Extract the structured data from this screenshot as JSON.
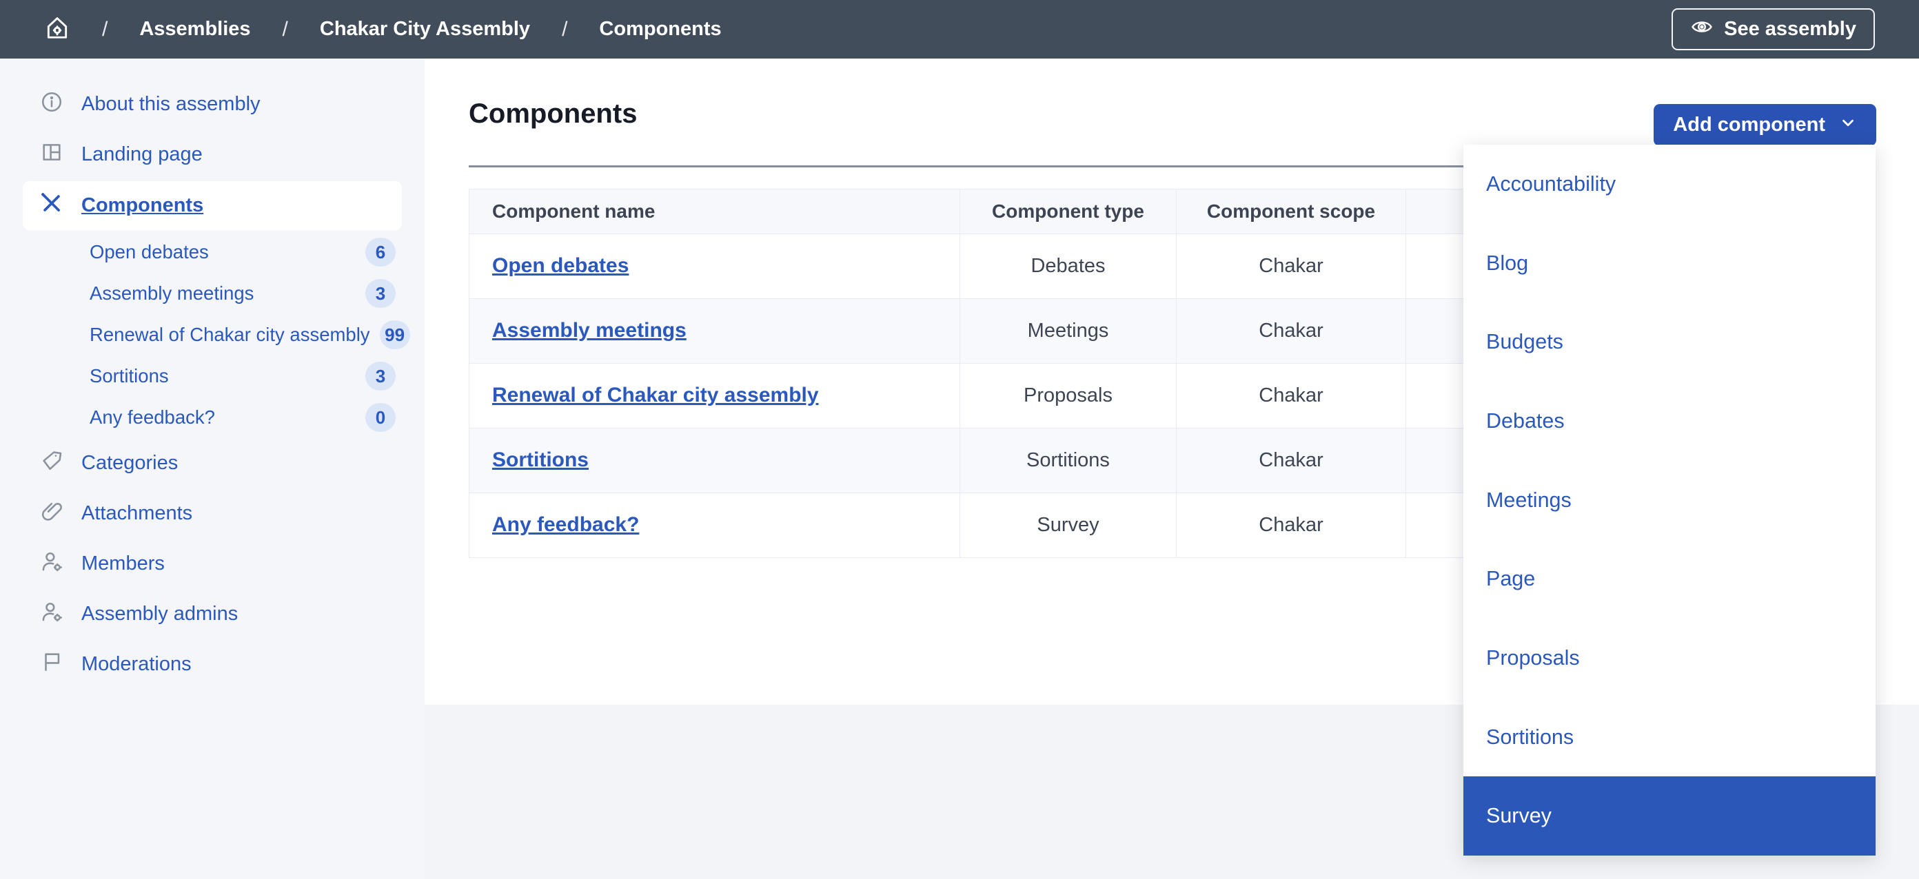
{
  "colors": {
    "topbar_bg": "#424d5c",
    "primary_button_blue": "#2a52b4",
    "link_blue": "#2b58bd",
    "menu_highlight_blue": "#2b57b8",
    "sidebar_bg": "#f4f6f9",
    "page_bg": "#f3f4f7",
    "badge_bg": "#dbe5f8",
    "table_border": "#e8ebf3",
    "table_header_bg": "#f7f8fb",
    "row_alt_bg": "#f8f9fd"
  },
  "topbar": {
    "separator": "/",
    "breadcrumb": [
      {
        "label": "Assemblies"
      },
      {
        "label": "Chakar City Assembly"
      },
      {
        "label": "Components"
      }
    ],
    "see_assembly": {
      "label": "See assembly"
    }
  },
  "sidebar": {
    "items": [
      {
        "label": "About this assembly",
        "icon": "info-icon"
      },
      {
        "label": "Landing page",
        "icon": "landing-page-icon"
      },
      {
        "label": "Components",
        "icon": "components-tools-icon",
        "selected": true
      }
    ],
    "component_subitems": [
      {
        "label": "Open debates",
        "count": "6"
      },
      {
        "label": "Assembly meetings",
        "count": "3"
      },
      {
        "label": "Renewal of Chakar city assembly",
        "count": "99"
      },
      {
        "label": "Sortitions",
        "count": "3"
      },
      {
        "label": "Any feedback?",
        "count": "0"
      }
    ],
    "lower_items": [
      {
        "label": "Categories",
        "icon": "tag-icon"
      },
      {
        "label": "Attachments",
        "icon": "paperclip-icon"
      },
      {
        "label": "Members",
        "icon": "member-gear-icon"
      },
      {
        "label": "Assembly admins",
        "icon": "admin-gear-icon"
      },
      {
        "label": "Moderations",
        "icon": "flag-icon"
      }
    ]
  },
  "main": {
    "title": "Components",
    "add_component": {
      "label": "Add component"
    },
    "table": {
      "headers": [
        "Component name",
        "Component type",
        "Component scope"
      ],
      "rows": [
        {
          "name": "Open debates",
          "type": "Debates",
          "scope": "Chakar"
        },
        {
          "name": "Assembly meetings",
          "type": "Meetings",
          "scope": "Chakar"
        },
        {
          "name": "Renewal of Chakar city assembly",
          "type": "Proposals",
          "scope": "Chakar"
        },
        {
          "name": "Sortitions",
          "type": "Sortitions",
          "scope": "Chakar"
        },
        {
          "name": "Any feedback?",
          "type": "Survey",
          "scope": "Chakar"
        }
      ]
    }
  },
  "add_component_menu": {
    "items": [
      "Accountability",
      "Blog",
      "Budgets",
      "Debates",
      "Meetings",
      "Page",
      "Proposals",
      "Sortitions",
      "Survey"
    ],
    "highlighted": "Survey"
  }
}
